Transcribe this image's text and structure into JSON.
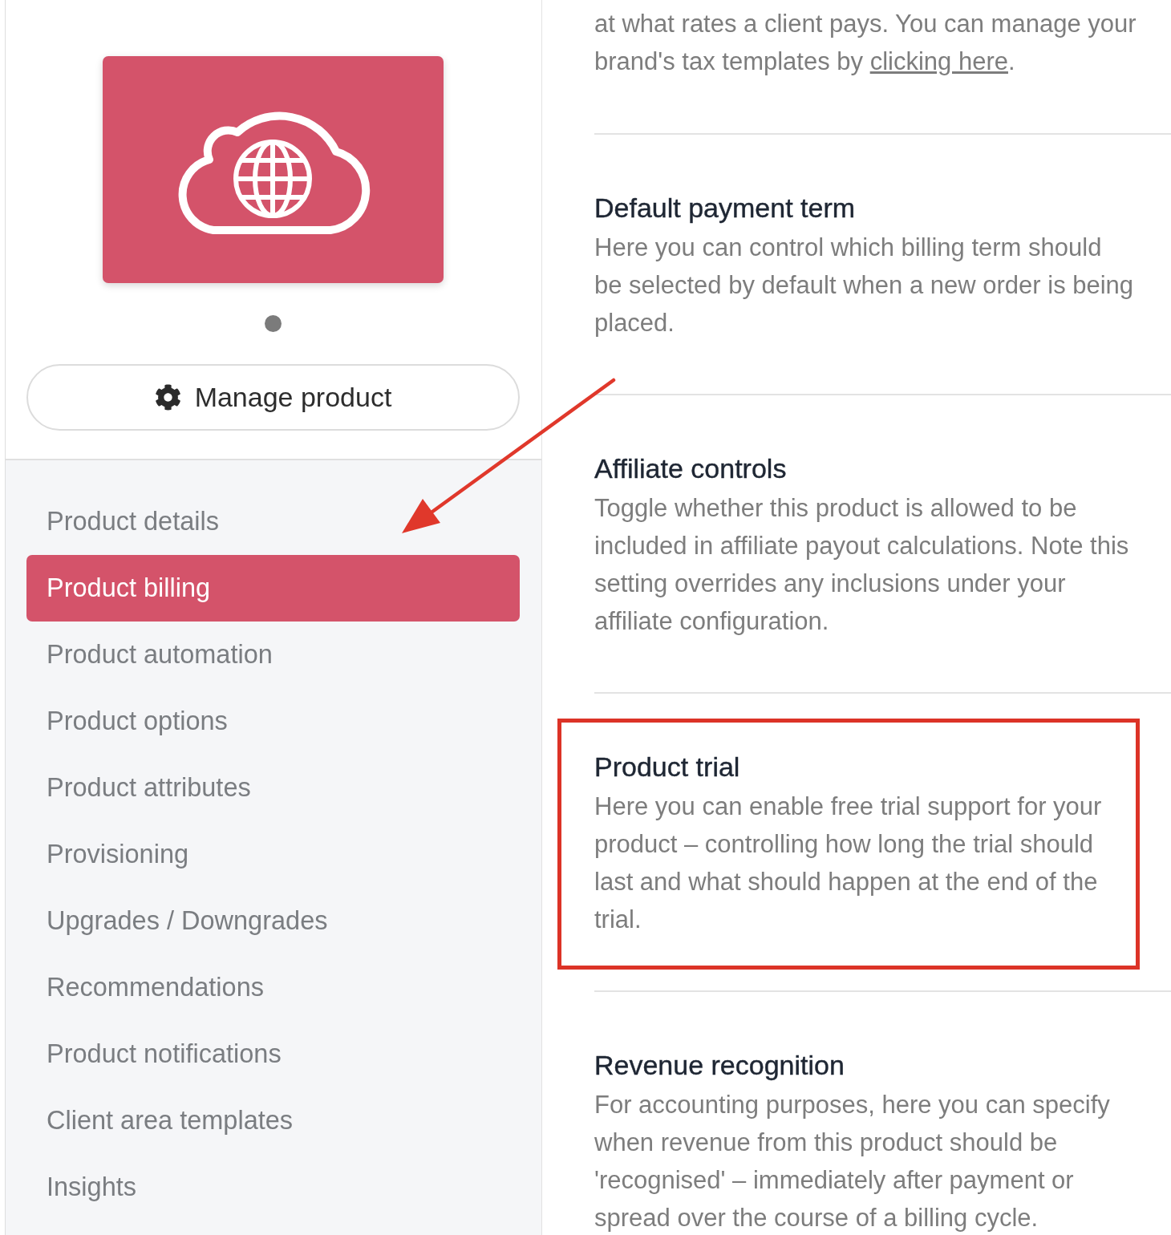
{
  "sidebar": {
    "carousel_dots": [
      {
        "selected": true
      }
    ],
    "manage_button": {
      "label": "Manage product"
    },
    "nav": [
      {
        "label": "Product details",
        "selected": false
      },
      {
        "label": "Product billing",
        "selected": true
      },
      {
        "label": "Product automation",
        "selected": false
      },
      {
        "label": "Product options",
        "selected": false
      },
      {
        "label": "Product attributes",
        "selected": false
      },
      {
        "label": "Provisioning",
        "selected": false
      },
      {
        "label": "Upgrades / Downgrades",
        "selected": false
      },
      {
        "label": "Recommendations",
        "selected": false
      },
      {
        "label": "Product notifications",
        "selected": false
      },
      {
        "label": "Client area templates",
        "selected": false
      },
      {
        "label": "Insights",
        "selected": false
      }
    ]
  },
  "content": {
    "intro": {
      "text": "at what rates a client pays. You can manage your brand's tax templates by ",
      "link": "clicking here",
      "text_after": "."
    },
    "sections": [
      {
        "title": "Default payment term",
        "description": "Here you can control which billing term should be selected by default when a new order is being placed.",
        "highlighted": false
      },
      {
        "title": "Affiliate controls",
        "description": "Toggle whether this product is allowed to be included in affiliate payout calculations. Note this setting overrides any inclusions under your affiliate configuration.",
        "highlighted": false
      },
      {
        "title": "Product trial",
        "description": "Here you can enable free trial support for your product – controlling how long the trial should last and what should happen at the end of the trial.",
        "highlighted": true
      },
      {
        "title": "Revenue recognition",
        "description": "For accounting purposes, here you can specify when revenue from this product should be 'recognised' – immediately after payment or spread over the course of a billing cycle.",
        "highlighted": false
      }
    ]
  }
}
